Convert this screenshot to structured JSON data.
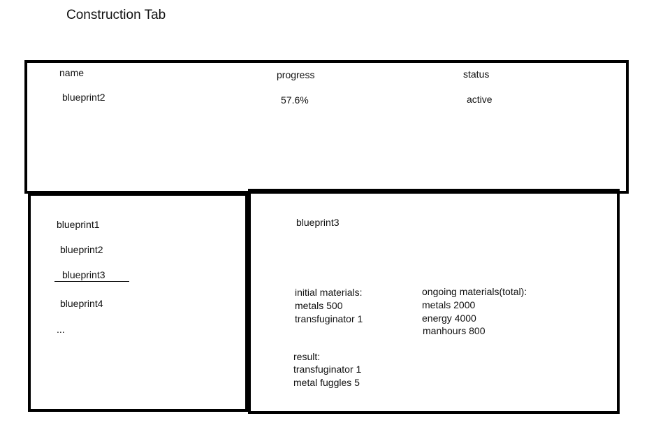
{
  "page_title": "Construction Tab",
  "active_panel": {
    "headers": {
      "name": "name",
      "progress": "progress",
      "status": "status"
    },
    "row": {
      "name": "blueprint2",
      "progress": "57.6%",
      "status": "active"
    }
  },
  "blueprint_list": {
    "items": [
      "blueprint1",
      "blueprint2",
      "blueprint3",
      "blueprint4",
      "..."
    ],
    "selected": "blueprint3"
  },
  "detail": {
    "title": "blueprint3",
    "initial_materials": {
      "label": "initial materials:",
      "items": [
        "metals 500",
        "transfuginator 1"
      ]
    },
    "ongoing_materials": {
      "label": "ongoing materials(total):",
      "items": [
        "metals 2000",
        "energy 4000",
        "manhours 800"
      ]
    },
    "result": {
      "label": "result:",
      "items": [
        "transfuginator 1",
        "metal fuggles 5"
      ]
    }
  }
}
